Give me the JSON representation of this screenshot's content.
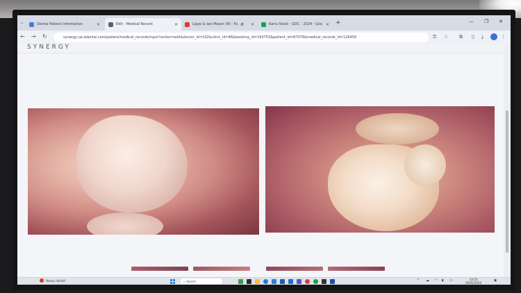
{
  "tabs": [
    {
      "label": "Dental Patient Information",
      "color": "#4a7cd8"
    },
    {
      "label": "Edit - Medical Record",
      "color": "#5b6272"
    },
    {
      "label": "Lipps & Ipsi Mason 90 - Fa",
      "color": "#e03b2f"
    },
    {
      "label": "Karlu Stock - GDC - 2024 - Goo",
      "color": "#1e9e56"
    }
  ],
  "address": {
    "url": "synergy-ua.adental.com/patient/medical_records/input?action=edit&doctor_id=102&clinic_id=46&booking_id=193753&patient_id=87076&medical_records_id=126459"
  },
  "page": {
    "brand": "SYNERGY"
  },
  "taskbar": {
    "weather": "Heavy rainfall",
    "search_placeholder": "Search",
    "time": "13:53",
    "date": "29/05/2024"
  }
}
